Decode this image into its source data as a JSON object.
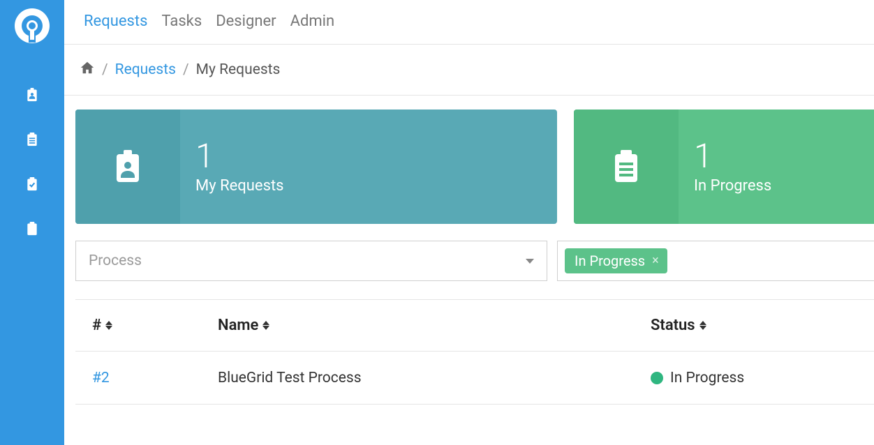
{
  "nav": {
    "items": [
      {
        "label": "Requests",
        "active": true
      },
      {
        "label": "Tasks"
      },
      {
        "label": "Designer"
      },
      {
        "label": "Admin"
      }
    ]
  },
  "breadcrumb": {
    "link": "Requests",
    "current": "My Requests"
  },
  "cards": {
    "my_requests": {
      "count": "1",
      "label": "My Requests"
    },
    "in_progress": {
      "count": "1",
      "label": "In Progress"
    }
  },
  "filters": {
    "process_placeholder": "Process",
    "tag_label": "In Progress"
  },
  "table": {
    "headers": {
      "id": "#",
      "name": "Name",
      "status": "Status"
    },
    "rows": [
      {
        "id": "#2",
        "name": "BlueGrid Test Process",
        "status": "In Progress"
      }
    ]
  }
}
